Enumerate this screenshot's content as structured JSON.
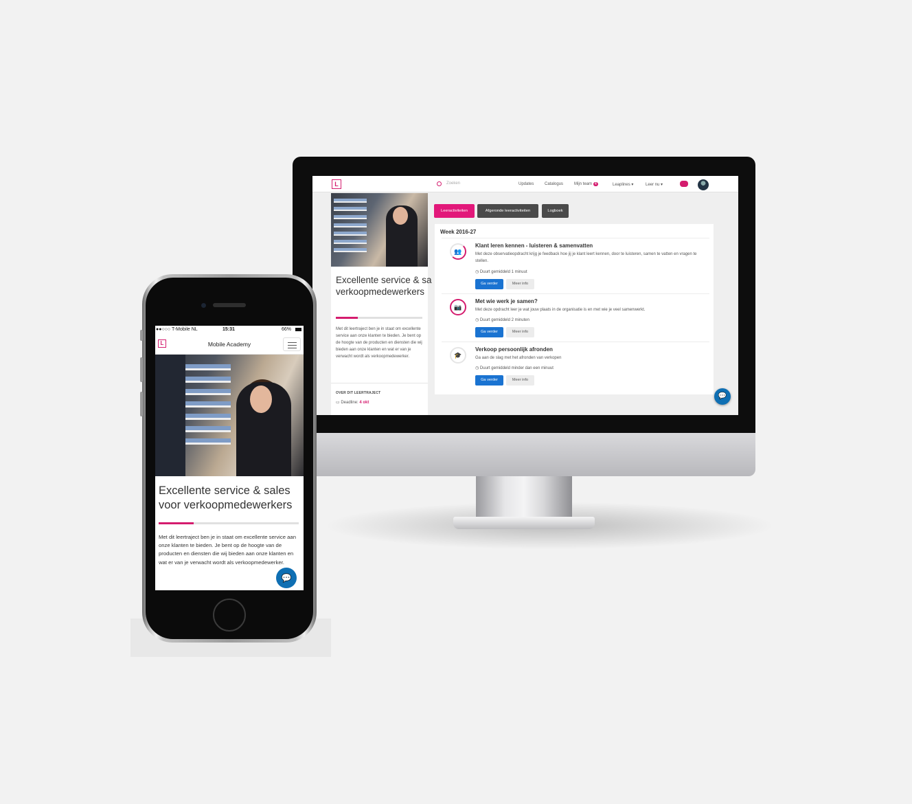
{
  "desktop": {
    "nav": {
      "logo": "L",
      "search_placeholder": "Zoeken",
      "links": {
        "updates": "Updates",
        "catalog": "Catalogus",
        "team": "Mijn team",
        "team_count": "4",
        "leaplines": "Leaplines ▾",
        "learn_now": "Leer nu ▾"
      }
    },
    "course": {
      "title": "Excellente service & sales voor verkoopmedewerkers",
      "progress": 0.25,
      "description": "Met dit leertraject ben je in staat om excellente service aan onze klanten te bieden. Je bent op de hoogte van de producten en diensten die wij bieden aan onze klanten en wat er van je verwacht wordt als verkoopmedewerker.",
      "about_label": "OVER DIT LEERTRAJECT",
      "deadline_label": "Deadline: ",
      "deadline_value": "4 okt"
    },
    "tabs": [
      "Leeractiviteiten",
      "Afgeronde leeractiviteiten",
      "Logboek"
    ],
    "week_label": "Week 2016-27",
    "activities": [
      {
        "icon": "people-icon",
        "title": "Klant leren kennen - luisteren & samenvatten",
        "description": "Met deze observatieopdracht krijg je feedback hoe jij je klant leert kennen, door te luisteren, samen te vatten en vragen te stellen.",
        "duration": "Duurt gemiddeld 1 minuut",
        "go": "Ga verder",
        "info": "Meer info"
      },
      {
        "icon": "camera-icon",
        "title": "Met wie werk je samen?",
        "description": "Met deze opdracht leer je wat jouw plaats in de organisatie is en met wie je veel samenwerkt.",
        "duration": "Duurt gemiddeld 2 minuten",
        "go": "Ga verder",
        "info": "Meer info"
      },
      {
        "icon": "graduation-cap-icon",
        "title": "Verkoop persoonlijk afronden",
        "description": "Ga aan de slag met het afronden van verkopen",
        "duration": "Duurt gemiddeld minder dan een minuut",
        "go": "Ga verder",
        "info": "Meer info"
      }
    ],
    "colors": {
      "accent": "#d41c6e",
      "primary_button": "#1a73d1",
      "chat": "#0f6fb3"
    }
  },
  "mobile": {
    "status": {
      "carrier": "●●○○○ T-Mobile NL",
      "time": "15:31",
      "battery": "66%"
    },
    "app_title": "Mobile Academy",
    "course_title": "Excellente service & sales voor verkoopmedewerkers",
    "progress": 0.25,
    "description": "Met dit leertraject ben je in staat om excellente service aan onze klanten te bieden. Je bent op de hoogte van de producten en diensten die wij bieden aan onze klanten en wat er van je verwacht wordt als verkoopmedewerker."
  }
}
